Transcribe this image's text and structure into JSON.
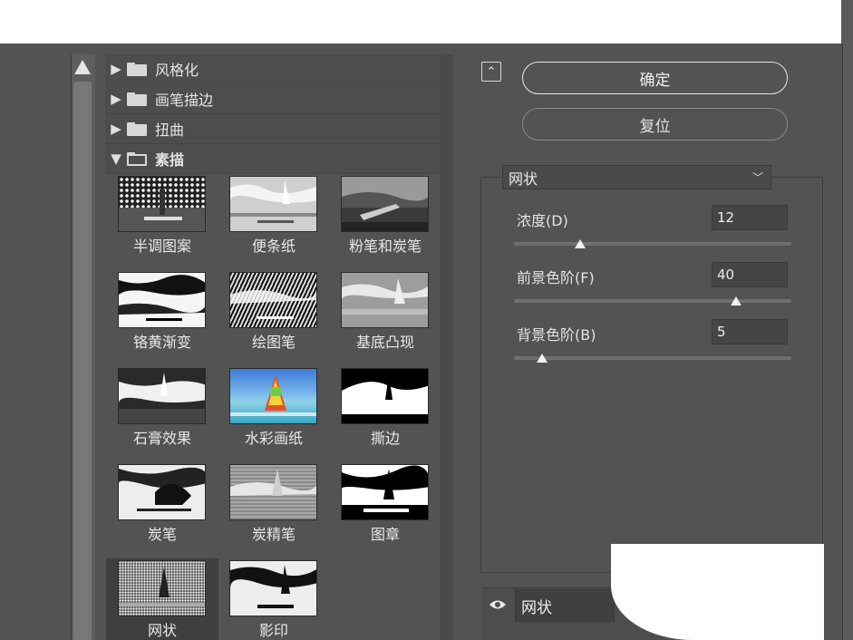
{
  "categories": [
    {
      "label": "风格化",
      "expanded": false
    },
    {
      "label": "画笔描边",
      "expanded": false
    },
    {
      "label": "扭曲",
      "expanded": false
    },
    {
      "label": "素描",
      "expanded": true
    }
  ],
  "filters": [
    {
      "label": "半调图案"
    },
    {
      "label": "便条纸"
    },
    {
      "label": "粉笔和炭笔"
    },
    {
      "label": "铬黄渐变"
    },
    {
      "label": "绘图笔"
    },
    {
      "label": "基底凸现"
    },
    {
      "label": "石膏效果"
    },
    {
      "label": "水彩画纸"
    },
    {
      "label": "撕边"
    },
    {
      "label": "炭笔"
    },
    {
      "label": "炭精笔"
    },
    {
      "label": "图章"
    },
    {
      "label": "网状"
    },
    {
      "label": "影印"
    }
  ],
  "selected_filter": "网状",
  "buttons": {
    "ok": "确定",
    "reset": "复位"
  },
  "filter_select": {
    "value": "网状"
  },
  "params": [
    {
      "label": "浓度(D)",
      "value": "12",
      "slider": 0.24
    },
    {
      "label": "前景色阶(F)",
      "value": "40",
      "slider": 0.8
    },
    {
      "label": "背景色阶(B)",
      "value": "5",
      "slider": 0.1
    }
  ],
  "layer": {
    "name": "网状"
  }
}
